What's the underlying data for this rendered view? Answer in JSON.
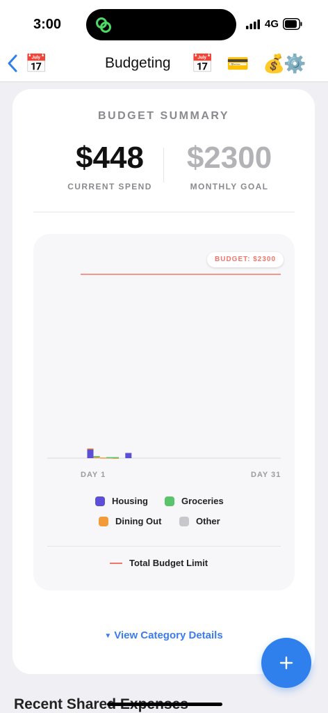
{
  "status_bar": {
    "time": "3:00",
    "network": "4G"
  },
  "nav": {
    "title": "Budgeting",
    "left_emoji": "📅",
    "right_emojis": [
      "📅",
      "💳",
      "💰",
      "⚙️"
    ]
  },
  "summary": {
    "title": "BUDGET SUMMARY",
    "current_value": "$448",
    "current_label": "CURRENT SPEND",
    "goal_value": "$2300",
    "goal_label": "MONTHLY GOAL"
  },
  "chart": {
    "budget_pill": "BUDGET: $2300",
    "x_start_label": "DAY 1",
    "x_end_label": "DAY 31",
    "legend_limit_label": "Total Budget Limit"
  },
  "chart_data": {
    "type": "bar",
    "stacked": true,
    "x_range": [
      1,
      31
    ],
    "y_range": [
      0,
      2300
    ],
    "budget_limit": 2300,
    "series": [
      {
        "name": "Housing",
        "color": "#5b4fd6",
        "points": [
          {
            "day": 1,
            "value": 115
          },
          {
            "day": 7,
            "value": 65
          }
        ]
      },
      {
        "name": "Groceries",
        "color": "#5ac46b",
        "points": [
          {
            "day": 2,
            "value": 14
          },
          {
            "day": 4,
            "value": 5
          },
          {
            "day": 5,
            "value": 8
          }
        ]
      },
      {
        "name": "Dining Out",
        "color": "#f29b38",
        "points": [
          {
            "day": 1,
            "value": 8
          },
          {
            "day": 2,
            "value": 12
          },
          {
            "day": 3,
            "value": 8
          },
          {
            "day": 4,
            "value": 8
          },
          {
            "day": 5,
            "value": 5
          }
        ]
      },
      {
        "name": "Other",
        "color": "#c7c7cc",
        "points": []
      }
    ]
  },
  "details_link": "View Category Details",
  "recent_heading": "Recent Shared Expenses",
  "colors": {
    "accent": "#2f80ed",
    "budget_line": "#f0766b"
  },
  "icons": {
    "fab": "plus-icon",
    "back": "chevron-left-icon"
  }
}
